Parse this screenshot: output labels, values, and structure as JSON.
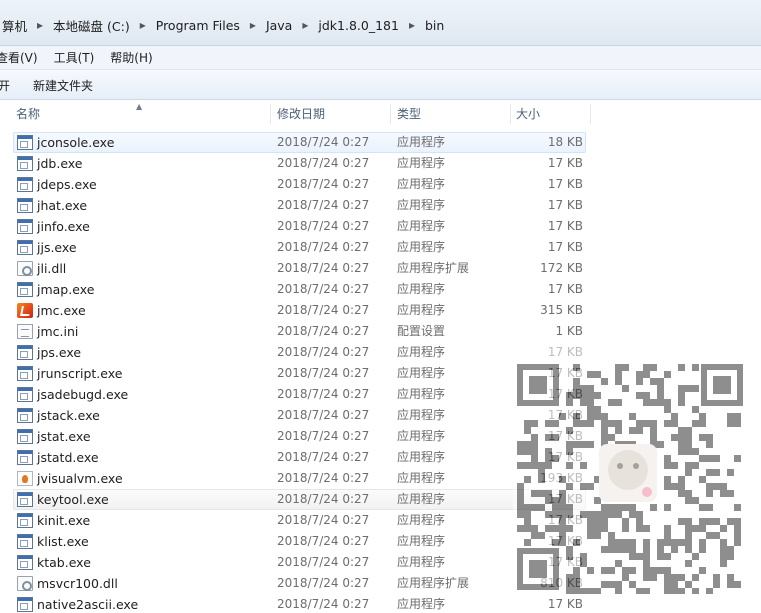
{
  "breadcrumb": [
    "算机",
    "本地磁盘 (C:)",
    "Program Files",
    "Java",
    "jdk1.8.0_181",
    "bin"
  ],
  "menubar": [
    "查看(V)",
    "工具(T)",
    "帮助(H)"
  ],
  "toolbar": {
    "open_label": "开",
    "new_folder_label": "新建文件夹"
  },
  "columns": {
    "name": "名称",
    "date": "修改日期",
    "type": "类型",
    "size": "大小"
  },
  "files": [
    {
      "name": "jconsole.exe",
      "date": "2018/7/24 0:27",
      "type": "应用程序",
      "size": "18 KB",
      "icon": "exe-icon",
      "highlight": "hover"
    },
    {
      "name": "jdb.exe",
      "date": "2018/7/24 0:27",
      "type": "应用程序",
      "size": "17 KB",
      "icon": "exe-icon"
    },
    {
      "name": "jdeps.exe",
      "date": "2018/7/24 0:27",
      "type": "应用程序",
      "size": "17 KB",
      "icon": "exe-icon"
    },
    {
      "name": "jhat.exe",
      "date": "2018/7/24 0:27",
      "type": "应用程序",
      "size": "17 KB",
      "icon": "exe-icon"
    },
    {
      "name": "jinfo.exe",
      "date": "2018/7/24 0:27",
      "type": "应用程序",
      "size": "17 KB",
      "icon": "exe-icon"
    },
    {
      "name": "jjs.exe",
      "date": "2018/7/24 0:27",
      "type": "应用程序",
      "size": "17 KB",
      "icon": "exe-icon"
    },
    {
      "name": "jli.dll",
      "date": "2018/7/24 0:27",
      "type": "应用程序扩展",
      "size": "172 KB",
      "icon": "dll-icon"
    },
    {
      "name": "jmap.exe",
      "date": "2018/7/24 0:27",
      "type": "应用程序",
      "size": "17 KB",
      "icon": "exe-icon"
    },
    {
      "name": "jmc.exe",
      "date": "2018/7/24 0:27",
      "type": "应用程序",
      "size": "315 KB",
      "icon": "jmc-icon"
    },
    {
      "name": "jmc.ini",
      "date": "2018/7/24 0:27",
      "type": "配置设置",
      "size": "1 KB",
      "icon": "ini-icon"
    },
    {
      "name": "jps.exe",
      "date": "2018/7/24 0:27",
      "type": "应用程序",
      "size": "17 KB",
      "icon": "exe-icon"
    },
    {
      "name": "jrunscript.exe",
      "date": "2018/7/24 0:27",
      "type": "应用程序",
      "size": "17 KB",
      "icon": "exe-icon"
    },
    {
      "name": "jsadebugd.exe",
      "date": "2018/7/24 0:27",
      "type": "应用程序",
      "size": "17 KB",
      "icon": "exe-icon"
    },
    {
      "name": "jstack.exe",
      "date": "2018/7/24 0:27",
      "type": "应用程序",
      "size": "17 KB",
      "icon": "exe-icon"
    },
    {
      "name": "jstat.exe",
      "date": "2018/7/24 0:27",
      "type": "应用程序",
      "size": "17 KB",
      "icon": "exe-icon"
    },
    {
      "name": "jstatd.exe",
      "date": "2018/7/24 0:27",
      "type": "应用程序",
      "size": "17 KB",
      "icon": "exe-icon"
    },
    {
      "name": "jvisualvm.exe",
      "date": "2018/7/24 0:27",
      "type": "应用程序",
      "size": "193 KB",
      "icon": "jvisualvm-icon"
    },
    {
      "name": "keytool.exe",
      "date": "2018/7/24 0:27",
      "type": "应用程序",
      "size": "17 KB",
      "icon": "exe-icon",
      "highlight": "faint"
    },
    {
      "name": "kinit.exe",
      "date": "2018/7/24 0:27",
      "type": "应用程序",
      "size": "17 KB",
      "icon": "exe-icon"
    },
    {
      "name": "klist.exe",
      "date": "2018/7/24 0:27",
      "type": "应用程序",
      "size": "17 KB",
      "icon": "exe-icon"
    },
    {
      "name": "ktab.exe",
      "date": "2018/7/24 0:27",
      "type": "应用程序",
      "size": "17 KB",
      "icon": "exe-icon"
    },
    {
      "name": "msvcr100.dll",
      "date": "2018/7/24 0:27",
      "type": "应用程序扩展",
      "size": "810 KB",
      "icon": "dll-icon"
    },
    {
      "name": "native2ascii.exe",
      "date": "2018/7/24 0:27",
      "type": "应用程序",
      "size": "17 KB",
      "icon": "exe-icon"
    }
  ]
}
